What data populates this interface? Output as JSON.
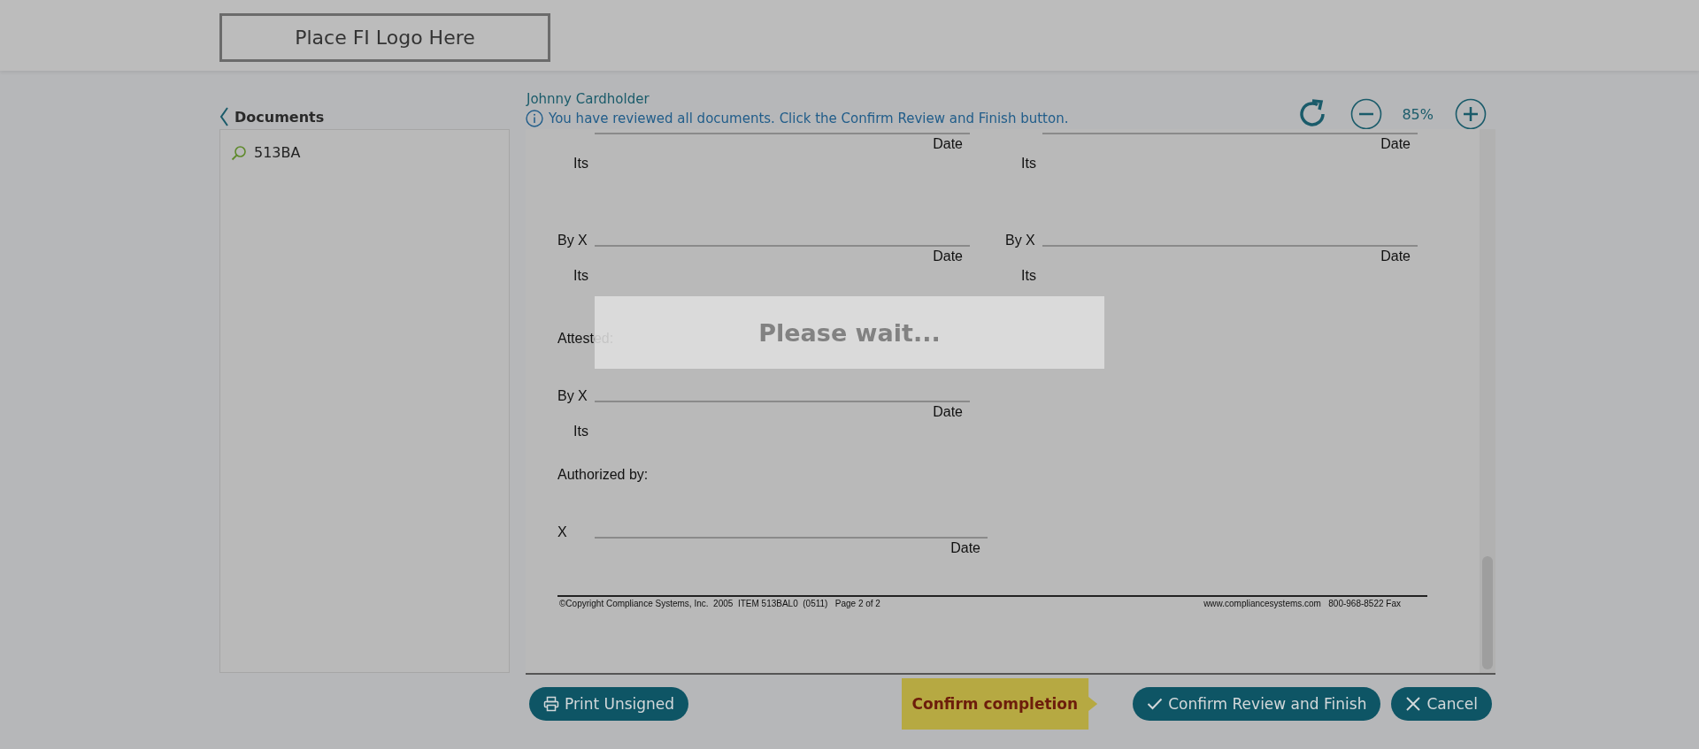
{
  "header": {
    "logo": "Place FI Logo Here"
  },
  "sidebar": {
    "title": "Documents",
    "items": [
      {
        "label": "513BA"
      }
    ]
  },
  "viewer": {
    "recipient": "Johnny Cardholder",
    "notice": "You have reviewed all documents. Click the Confirm Review and Finish button.",
    "zoom": "85%"
  },
  "document": {
    "blocks": [
      {
        "kind": "signature",
        "columns": [
          {
            "date": "Date",
            "title": "Its"
          },
          {
            "date": "Date",
            "title": "Its"
          }
        ]
      },
      {
        "kind": "signature",
        "columns": [
          {
            "prefix": "By X",
            "date": "Date",
            "title": "Its"
          },
          {
            "prefix": "By X",
            "date": "Date",
            "title": "Its"
          }
        ]
      },
      {
        "kind": "heading",
        "text": "Attested:"
      },
      {
        "kind": "signature",
        "columns": [
          {
            "prefix": "By X",
            "date": "Date",
            "title": "Its"
          }
        ]
      },
      {
        "kind": "heading",
        "text": "Authorized by:"
      },
      {
        "kind": "signature",
        "columns": [
          {
            "prefix": "X",
            "date": "Date"
          }
        ]
      }
    ],
    "footer": {
      "left": "©Copyright Compliance Systems, Inc.  2005  ITEM 513BAL0  (0511)   Page 2 of 2",
      "right": "www.compliancesystems.com   800-968-8522 Fax"
    }
  },
  "overlay": {
    "message": "Please wait..."
  },
  "tooltip": "Confirm completion",
  "buttons": [
    {
      "kind": "print",
      "label": "Print Unsigned"
    },
    {
      "kind": "confirm",
      "label": "Confirm Review and Finish"
    },
    {
      "kind": "cancel",
      "label": "Cancel"
    }
  ]
}
